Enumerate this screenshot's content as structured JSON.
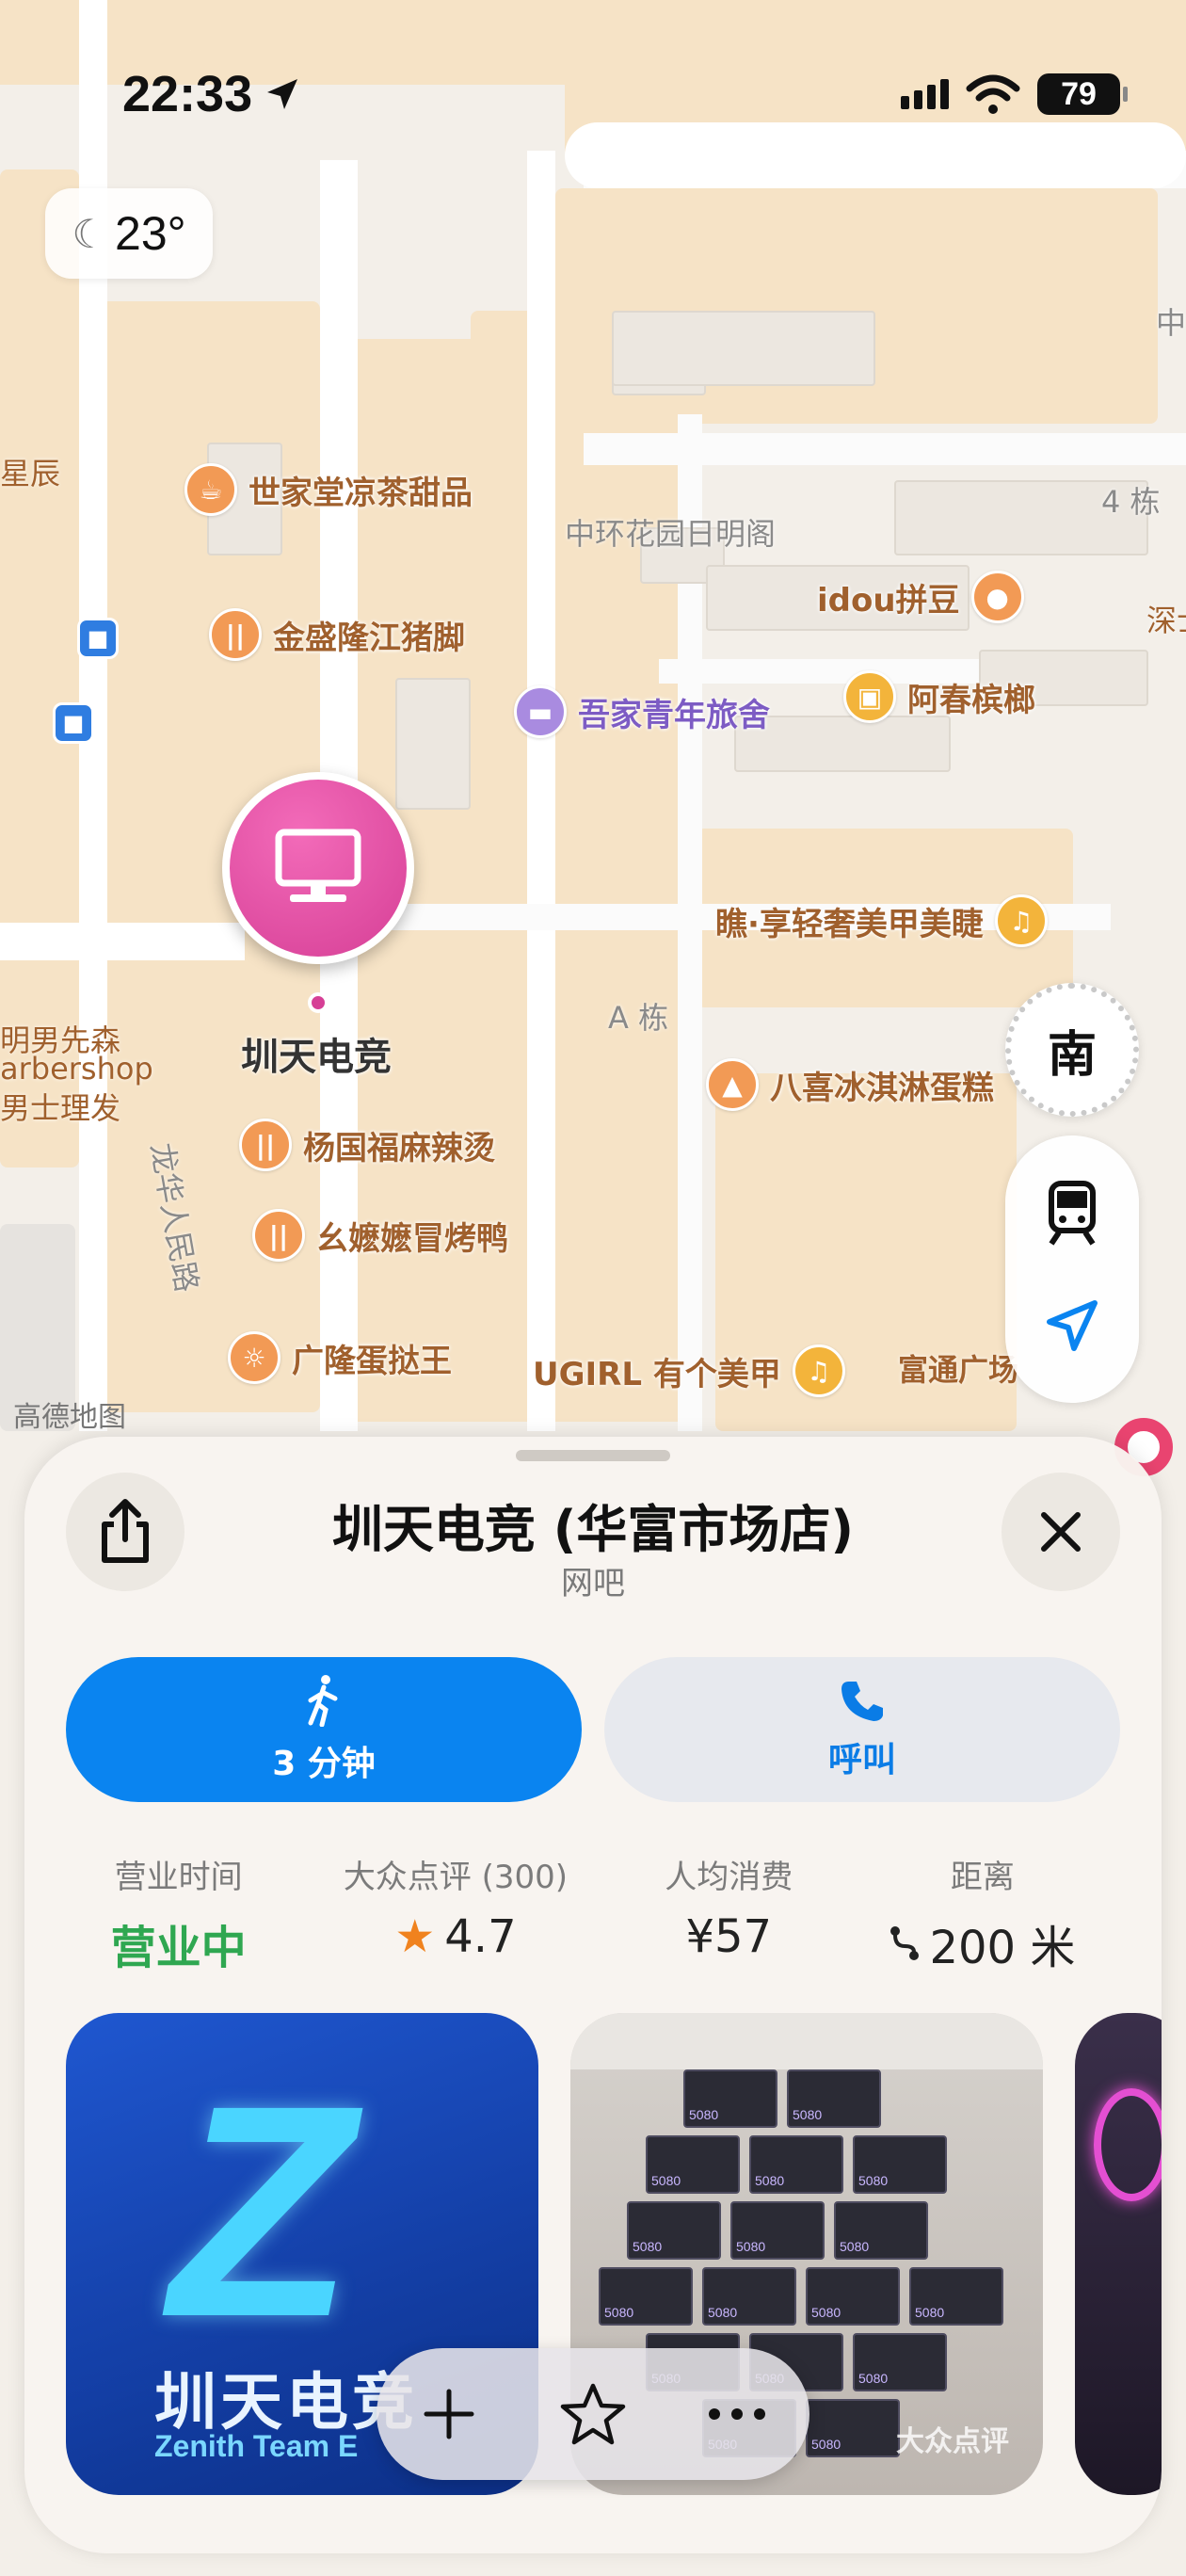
{
  "status_bar": {
    "time": "22:33",
    "battery": "79"
  },
  "weather": {
    "temperature": "23°",
    "icon": "moon-cloud-icon"
  },
  "map": {
    "labels": {
      "xingchen": "星辰",
      "zhonghuan": "中环花园日明阁",
      "building4": "4 栋",
      "buildingA": "A 栋",
      "road": "龙华人民路",
      "zhong": "中",
      "shen": "深士",
      "brand": "高德地图",
      "barber_1": "明男先森",
      "barber_2": "arbershop",
      "barber_3": "男士理发",
      "futong": "富通广场"
    },
    "pois": [
      {
        "name": "世家堂凉茶甜品",
        "icon": "drink-icon"
      },
      {
        "name": "金盛隆江猪脚",
        "icon": "fork-knife-icon"
      },
      {
        "name": "吾家青年旅舍",
        "icon": "bed-icon"
      },
      {
        "name": "idou拼豆",
        "icon": "circle-dot-icon"
      },
      {
        "name": "阿春槟榔",
        "icon": "bag-icon"
      },
      {
        "name": "瞧·享轻奢美甲美睫",
        "icon": "nail-icon"
      },
      {
        "name": "八喜冰淇淋蛋糕",
        "icon": "cake-icon"
      },
      {
        "name": "杨国福麻辣烫",
        "icon": "fork-knife-icon"
      },
      {
        "name": "幺嬷嬷冒烤鸭",
        "icon": "fork-knife-icon"
      },
      {
        "name": "广隆蛋挞王",
        "icon": "croissant-icon"
      },
      {
        "name": "UGIRL 有个美甲",
        "icon": "nail-icon"
      }
    ],
    "selected_marker": {
      "label": "圳天电竞",
      "icon": "desktop-computer-icon",
      "color": "#d63f96"
    },
    "compass": "南"
  },
  "place": {
    "title": "圳天电竞 (华富市场店)",
    "category": "网吧",
    "walk_label": "3 分钟",
    "call_label": "呼叫",
    "stats": [
      {
        "key": "营业时间",
        "value": "营业中"
      },
      {
        "key": "大众点评 (300)",
        "value": "4.7"
      },
      {
        "key": "人均消费",
        "value": "¥57"
      },
      {
        "key": "距离",
        "value": "200 米"
      }
    ],
    "photo_logo": {
      "letter": "Z",
      "cn": "圳天电竞",
      "en": "Zenith Team E"
    },
    "photo_watermark": "大众点评",
    "box_label": "5080"
  },
  "colors": {
    "primary_button": "#0a84f0",
    "open_status": "#2fa751",
    "star": "#f0821e",
    "marker": "#d63f96"
  }
}
